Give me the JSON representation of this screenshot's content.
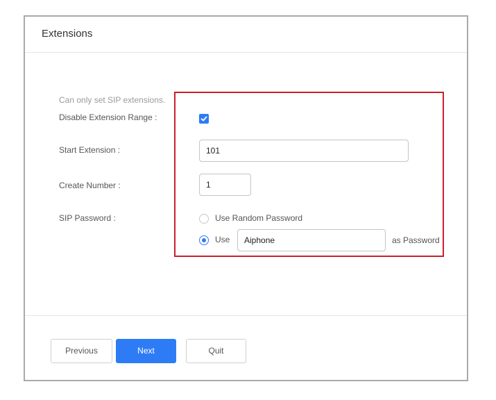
{
  "dialog": {
    "title": "Extensions",
    "hint": "Can only set SIP extensions.",
    "fields": {
      "disable_range_label": "Disable Extension Range :",
      "disable_range_checked": true,
      "start_extension_label": "Start Extension :",
      "start_extension_value": "101",
      "create_number_label": "Create Number :",
      "create_number_value": "1",
      "sip_password_label": "SIP Password :",
      "random_password_label": "Use Random Password",
      "use_label": "Use",
      "password_value": "Aiphone",
      "as_password_label": "as Password",
      "selected_option": "use-custom"
    },
    "buttons": {
      "previous": "Previous",
      "next": "Next",
      "quit": "Quit"
    }
  },
  "colors": {
    "accent": "#2d7cf6",
    "highlight_border": "#c8202a",
    "dialog_border": "#a9a9a9"
  },
  "icons": {
    "checkbox": "checkmark-icon"
  }
}
